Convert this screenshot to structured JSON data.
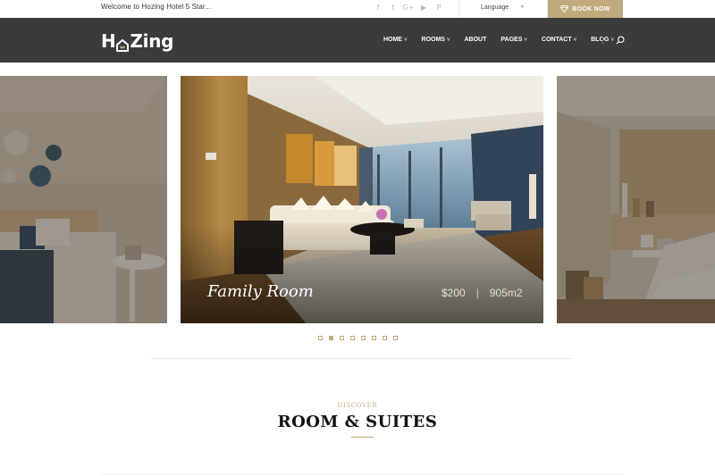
{
  "topbar": {
    "welcome": "Welcome to Hozing Hotel 5 Star...",
    "social_icons": [
      "facebook-icon",
      "twitter-icon",
      "google-plus-icon",
      "youtube-icon",
      "pinterest-icon"
    ],
    "social_glyphs": [
      "f",
      "t",
      "G+",
      "▶",
      "P"
    ],
    "language_label": "Language",
    "book_label": "BOOK NOW"
  },
  "header": {
    "logo_h": "H",
    "logo_rest": "Zing",
    "menu": [
      "HOME",
      "ROOMS",
      "ABOUT",
      "PAGES",
      "CONTACT",
      "BLOG"
    ],
    "menu_has_dropdown": [
      true,
      true,
      false,
      true,
      true,
      true
    ]
  },
  "slider": {
    "title": "Family Room",
    "price": "$200",
    "separator": "|",
    "size": "905m2",
    "dots_count": 8,
    "active_dot": 1
  },
  "section": {
    "eyebrow": "DISCOVER",
    "heading": "ROOM & SUITES"
  },
  "colors": {
    "accent": "#bfa97d",
    "nav_bg": "#3b3b3b"
  }
}
